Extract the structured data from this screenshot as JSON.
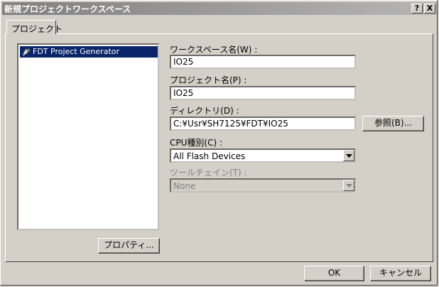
{
  "window": {
    "title": "新規プロジェクトワークスペース",
    "help_glyph": "?",
    "close_glyph": "X"
  },
  "tabs": [
    {
      "label": "プロジェクト"
    }
  ],
  "tree": {
    "items": [
      {
        "label": "FDT Project Generator",
        "icon": "project-generator-icon"
      }
    ]
  },
  "form": {
    "workspace_name_label": "ワークスペース名(W) :",
    "workspace_name_value": "IO25",
    "project_name_label": "プロジェクト名(P) :",
    "project_name_value": "IO25",
    "directory_label": "ディレクトリ(D) :",
    "directory_value": "C:¥Usr¥SH7125¥FDT¥IO25",
    "browse_label": "参照(B)...",
    "cpu_label": "CPU種別(C) :",
    "cpu_value": "All Flash Devices",
    "toolchain_label": "ツールチェイン(T) :",
    "toolchain_value": "None"
  },
  "buttons": {
    "properties_label": "プロパティ...",
    "ok_label": "OK",
    "cancel_label": "キャンセル"
  },
  "colors": {
    "face": "#d4d0c8",
    "selection": "#0a246a",
    "titlebar_start": "#808080",
    "titlebar_end": "#b6b6b6"
  }
}
